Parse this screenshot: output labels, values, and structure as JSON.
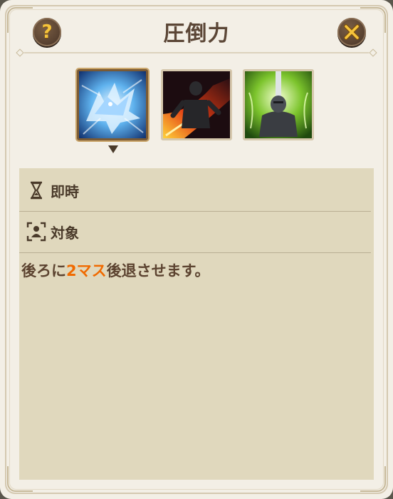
{
  "header": {
    "title": "圧倒力",
    "help_symbol": "?",
    "help_icon": "question-icon",
    "close_icon": "close-x-icon"
  },
  "skills": [
    {
      "name": "ice-wolf-skill-icon",
      "selected": true
    },
    {
      "name": "flame-slash-skill-icon",
      "selected": false
    },
    {
      "name": "holy-sword-knight-skill-icon",
      "selected": false
    }
  ],
  "details": {
    "timing_icon": "hourglass-icon",
    "timing_label": "即時",
    "target_icon": "target-person-icon",
    "target_label": "対象",
    "description_before": "後ろに",
    "description_highlight": "2マス",
    "description_after": "後退させます。",
    "highlight_color": "#f06a00"
  }
}
